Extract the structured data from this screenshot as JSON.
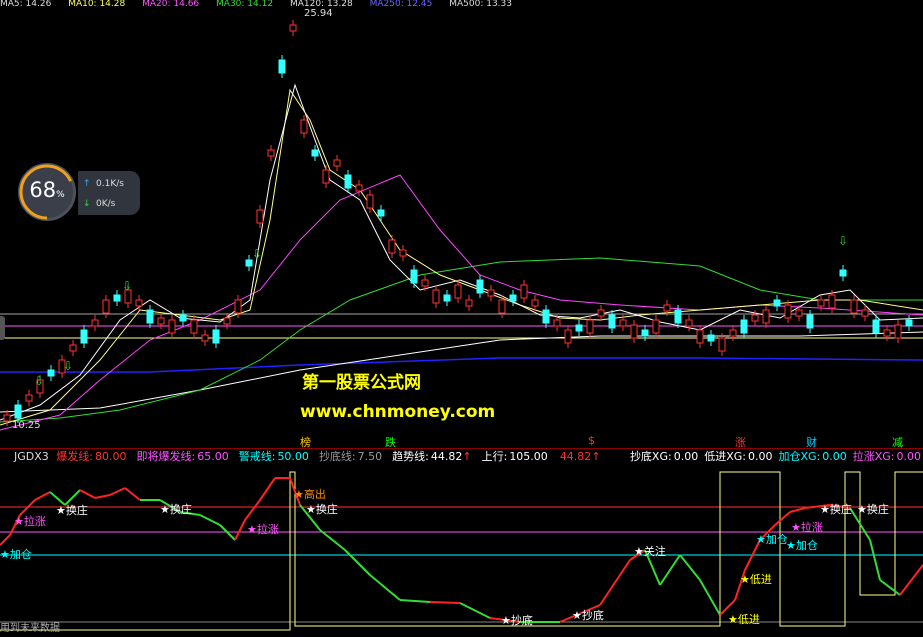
{
  "top_bar": {
    "items": [
      "MA5: 14.26",
      "MA10: 14.28",
      "MA20: 14.66",
      "MA30: 14.12",
      "MA120: 13.28",
      "MA250: 12.45",
      "MA500: 13.33"
    ]
  },
  "price": {
    "high_label": "25.94",
    "low_label": "10.25"
  },
  "speed_widget": {
    "percent": "68",
    "percent_unit": "%",
    "up_rate": "0.1K/s",
    "down_rate": "0K/s"
  },
  "watermark": {
    "line1": "第一股票公式网",
    "line2": "www.chnmoney.com"
  },
  "indicator": {
    "name": "JGDX3",
    "params": [
      {
        "label": "爆发线:",
        "value": "80.00",
        "color": "#ff3333"
      },
      {
        "label": "即将爆发线:",
        "value": "65.00",
        "color": "#ff55ff"
      },
      {
        "label": "警戒线:",
        "value": "50.00",
        "color": "#00ffff"
      },
      {
        "label": "抄底线:",
        "value": "7.50",
        "color": "#999999"
      },
      {
        "label": "趋势线:",
        "value": "44.82",
        "color": "#ffffff",
        "arrow": "↑"
      },
      {
        "label": "上行:",
        "value": "105.00",
        "color": "#ffffff"
      },
      {
        "label": "",
        "value": "44.82",
        "color": "#ff3333",
        "arrow": "↑"
      }
    ],
    "right_params": [
      {
        "label": "抄底XG:",
        "value": "0.00",
        "color": "#ffffff"
      },
      {
        "label": "低进XG:",
        "value": "0.00",
        "color": "#ffffff"
      },
      {
        "label": "加仓XG:",
        "value": "0.00",
        "color": "#00ffff"
      },
      {
        "label": "拉涨XG:",
        "value": "0.00",
        "color": "#ff55ff"
      }
    ]
  },
  "top_tags": [
    {
      "text": "榜",
      "color": "#ffcc00"
    },
    {
      "text": "跌",
      "color": "#00ff00"
    },
    {
      "text": "$",
      "color": "#ff3333"
    },
    {
      "text": "涨",
      "color": "#ff3333"
    },
    {
      "text": "财",
      "color": "#00ccff"
    },
    {
      "text": "减",
      "color": "#00ff00"
    }
  ],
  "signals": [
    {
      "text": "★加仓",
      "color": "#00ffff"
    },
    {
      "text": "★拉涨",
      "color": "#ff55ff"
    },
    {
      "text": "★换庄",
      "color": "#ffffff"
    },
    {
      "text": "★换庄",
      "color": "#ffffff"
    },
    {
      "text": "★拉涨",
      "color": "#ff55ff"
    },
    {
      "text": "★高出",
      "color": "#ff8800"
    },
    {
      "text": "★换庄",
      "color": "#ffffff"
    },
    {
      "text": "★关注",
      "color": "#ffffff"
    },
    {
      "text": "★抄底",
      "color": "#ffffff"
    },
    {
      "text": "★抄底",
      "color": "#ffffff"
    },
    {
      "text": "★低进",
      "color": "#ffff00"
    },
    {
      "text": "★低进",
      "color": "#ffff00"
    },
    {
      "text": "★加仓",
      "color": "#00ffff"
    },
    {
      "text": "★加仓",
      "color": "#00ffff"
    },
    {
      "text": "★拉涨",
      "color": "#ff55ff"
    },
    {
      "text": "★换庄",
      "color": "#ffffff"
    },
    {
      "text": "★换庄",
      "color": "#ffffff"
    }
  ],
  "footer": "用到未来数据"
}
